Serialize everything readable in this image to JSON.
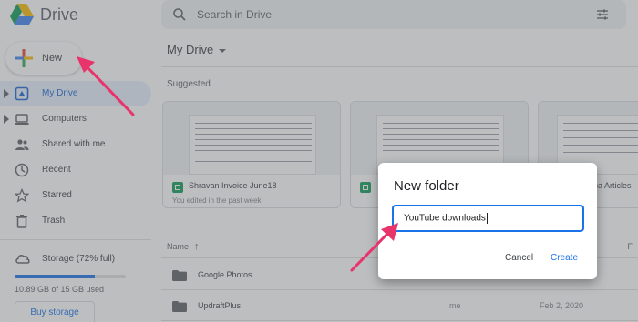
{
  "app": {
    "brand": "Drive"
  },
  "search": {
    "placeholder": "Search in Drive"
  },
  "sidebar": {
    "new_label": "New",
    "items": [
      {
        "label": "My Drive",
        "active": true,
        "has_arrow": true
      },
      {
        "label": "Computers",
        "active": false,
        "has_arrow": true
      },
      {
        "label": "Shared with me",
        "active": false
      },
      {
        "label": "Recent",
        "active": false
      },
      {
        "label": "Starred",
        "active": false
      },
      {
        "label": "Trash",
        "active": false
      }
    ],
    "storage": {
      "label": "Storage (72% full)",
      "used_fraction": 0.72,
      "used_text": "10.89 GB of 15 GB used",
      "buy_label": "Buy storage"
    }
  },
  "main": {
    "title": "My Drive",
    "suggested_label": "Suggested",
    "cards": [
      {
        "name": "Shravan Invoice June18",
        "subtitle": "You edited in the past week"
      },
      {
        "name": "",
        "subtitle": ""
      },
      {
        "name": "pa Articles",
        "subtitle": ""
      }
    ],
    "list": {
      "name_header": "Name",
      "right_header": "F",
      "rows": [
        {
          "name": "Google Photos",
          "owner": "",
          "date": ""
        },
        {
          "name": "UpdraftPlus",
          "owner": "me",
          "date": "Feb 2, 2020"
        }
      ]
    }
  },
  "dialog": {
    "title": "New folder",
    "input_value": "YouTube downloads",
    "cancel_label": "Cancel",
    "create_label": "Create"
  },
  "colors": {
    "accent": "#1a73e8",
    "annotation_arrow": "#e8336b",
    "sheets_green": "#0f9d58"
  }
}
